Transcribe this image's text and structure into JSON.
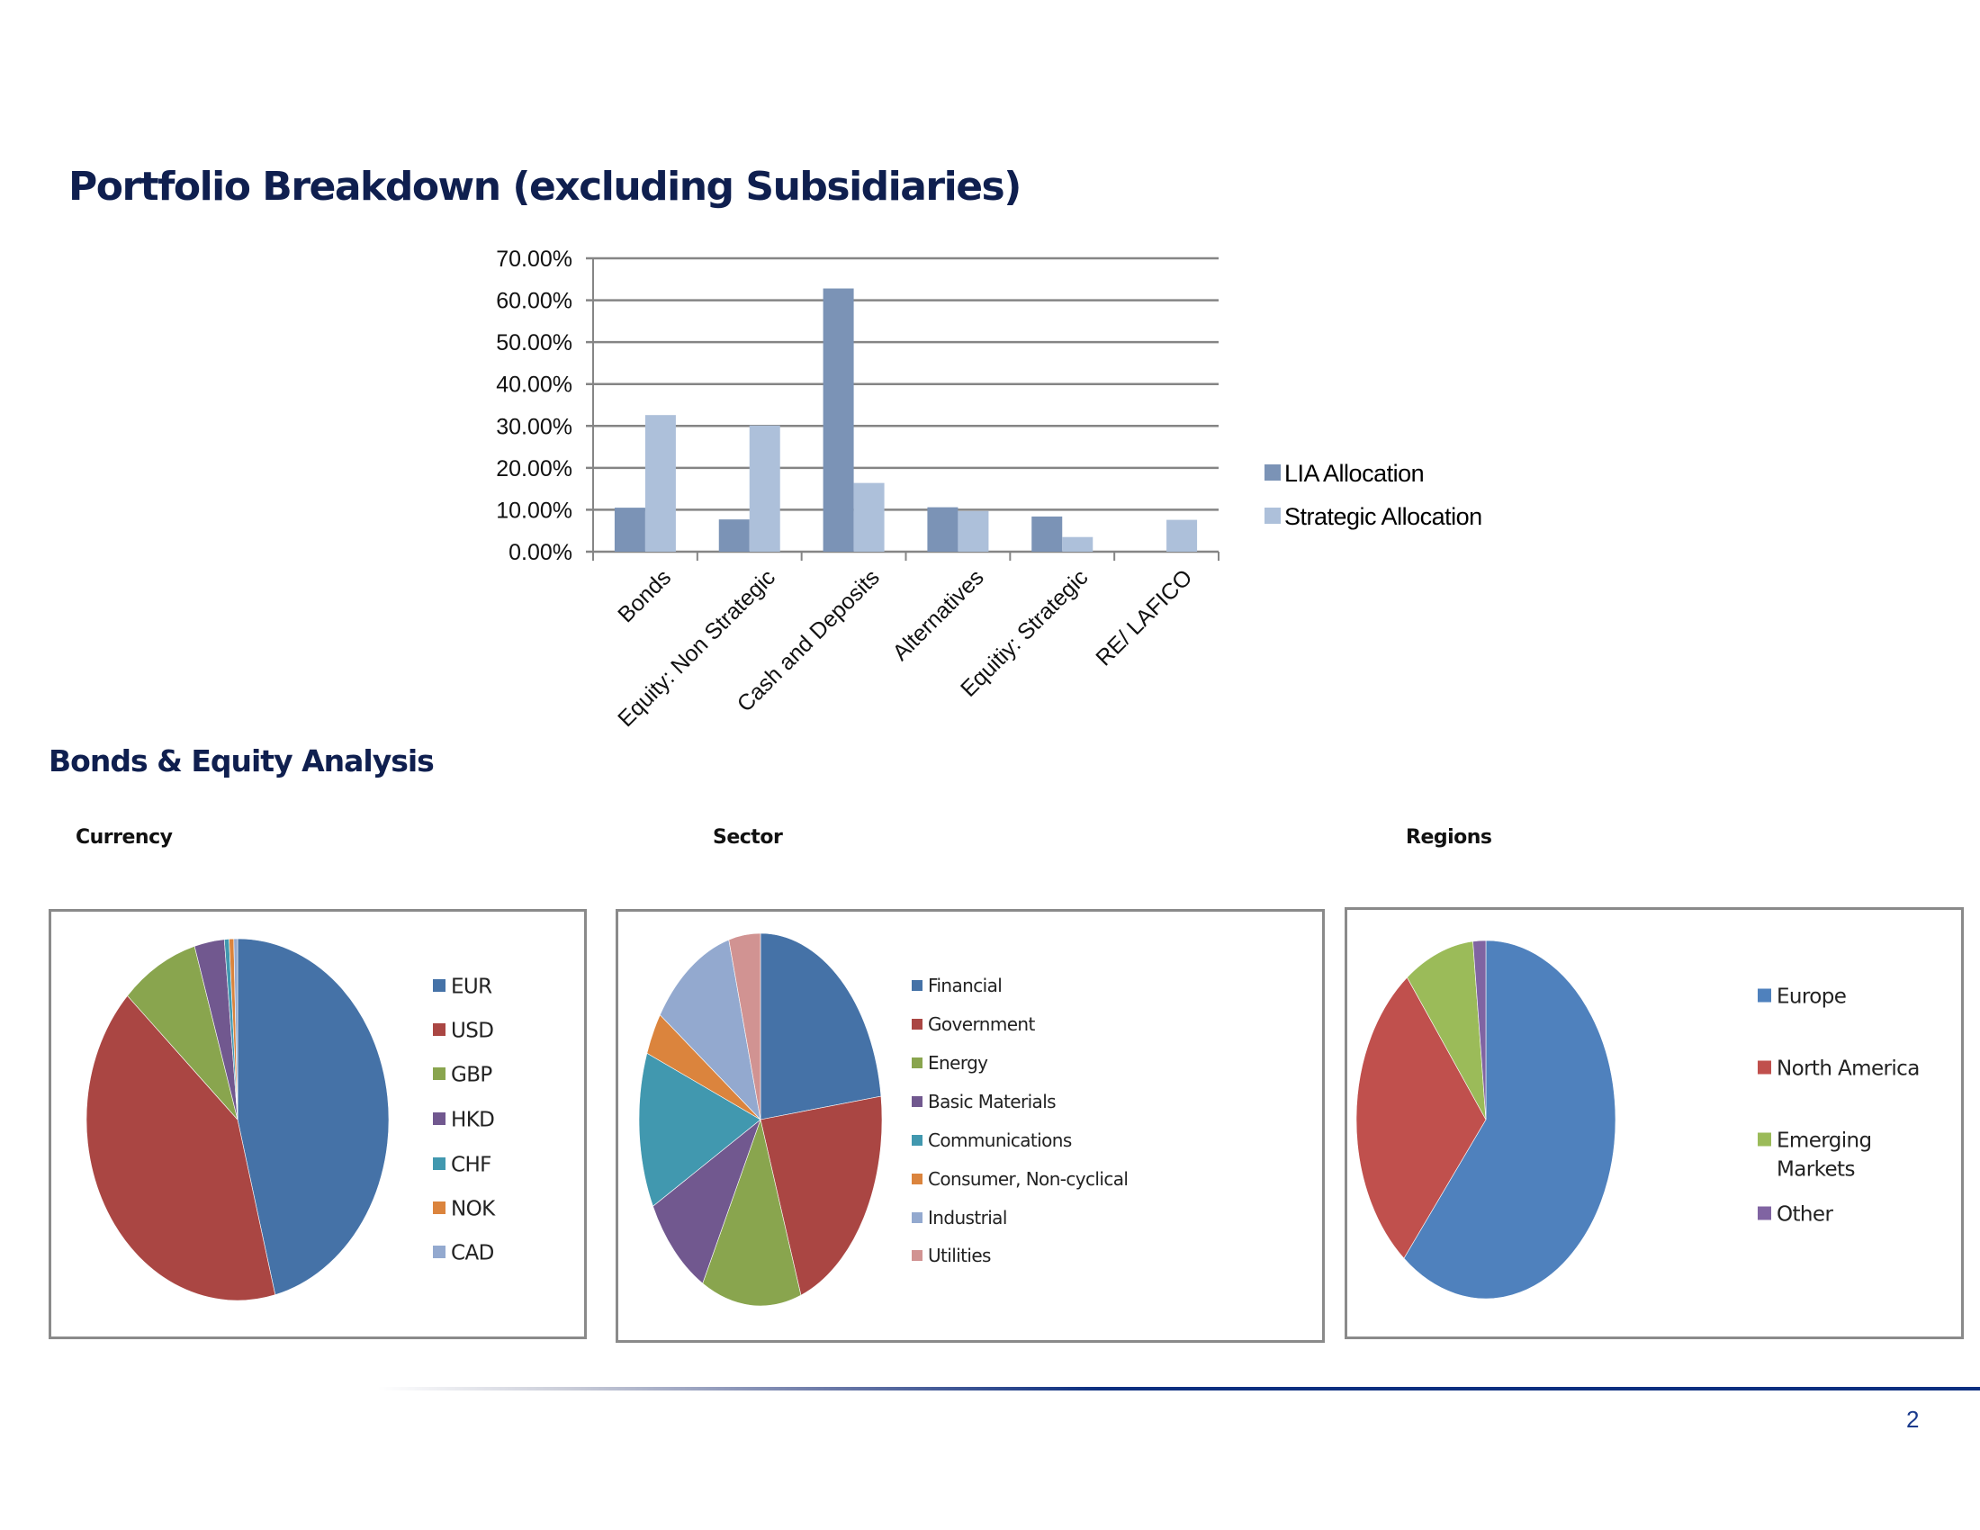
{
  "page": {
    "title": "Portfolio Breakdown (excluding Subsidiaries)",
    "section_title": "Bonds & Equity Analysis",
    "subtitles": {
      "currency": "Currency",
      "sector": "Sector",
      "regions": "Regions"
    },
    "page_number": "2",
    "colors": {
      "title": "#0f1f4f",
      "footer_line": "#0c2f80"
    }
  },
  "chart_data": [
    {
      "id": "allocation",
      "type": "bar",
      "title": "",
      "xlabel": "",
      "ylabel": "",
      "categories": [
        "Bonds",
        "Equity: Non Strategic",
        "Cash and Deposits",
        "Alternatives",
        "Equitiy: Strategic",
        "RE/ LAFICO"
      ],
      "series": [
        {
          "name": "LIA Allocation",
          "color": "#7b93b6",
          "values": [
            10.5,
            7.7,
            62.8,
            10.6,
            8.4,
            0
          ]
        },
        {
          "name": "Strategic Allocation",
          "color": "#adc0da",
          "values": [
            32.6,
            30.1,
            16.4,
            9.7,
            3.5,
            7.6
          ]
        }
      ],
      "y_ticks": [
        "0.00%",
        "10.00%",
        "20.00%",
        "30.00%",
        "40.00%",
        "50.00%",
        "60.00%",
        "70.00%"
      ],
      "ylim": [
        0,
        70
      ],
      "grid": true,
      "legend_position": "right"
    },
    {
      "id": "currency",
      "type": "pie",
      "title": "Currency",
      "labels": [
        "EUR",
        "USD",
        "GBP",
        "HKD",
        "CHF",
        "NOK",
        "CAD"
      ],
      "values": [
        46.0,
        41.0,
        8.4,
        3.2,
        0.5,
        0.5,
        0.4
      ],
      "colors": [
        "#4572a7",
        "#aa4643",
        "#89a54e",
        "#71588f",
        "#4198af",
        "#db843d",
        "#93a9cf"
      ],
      "legend_position": "right"
    },
    {
      "id": "sector",
      "type": "pie",
      "title": "Sector",
      "labels": [
        "Financial",
        "Government",
        "Energy",
        "Basic Materials",
        "Communications",
        "Consumer, Non-cyclical",
        "Industrial",
        "Utilities"
      ],
      "values": [
        23.0,
        21.6,
        13.3,
        9.4,
        13.5,
        3.7,
        11.3,
        4.2
      ],
      "colors": [
        "#4572a7",
        "#aa4643",
        "#89a54e",
        "#71588f",
        "#4198af",
        "#db843d",
        "#93a9cf",
        "#d19392"
      ],
      "legend_position": "right"
    },
    {
      "id": "regions",
      "type": "pie",
      "title": "Regions",
      "labels": [
        "Europe",
        "North America",
        "Emerging Markets",
        "Other"
      ],
      "legend_lines": [
        [
          "Europe"
        ],
        [
          "North America"
        ],
        [
          "Emerging",
          "Markets"
        ],
        [
          "Other"
        ]
      ],
      "values": [
        60.9,
        28.7,
        8.8,
        1.6
      ],
      "colors": [
        "#4f81bd",
        "#c0504d",
        "#9bbb59",
        "#8064a2"
      ],
      "legend_position": "right"
    }
  ]
}
